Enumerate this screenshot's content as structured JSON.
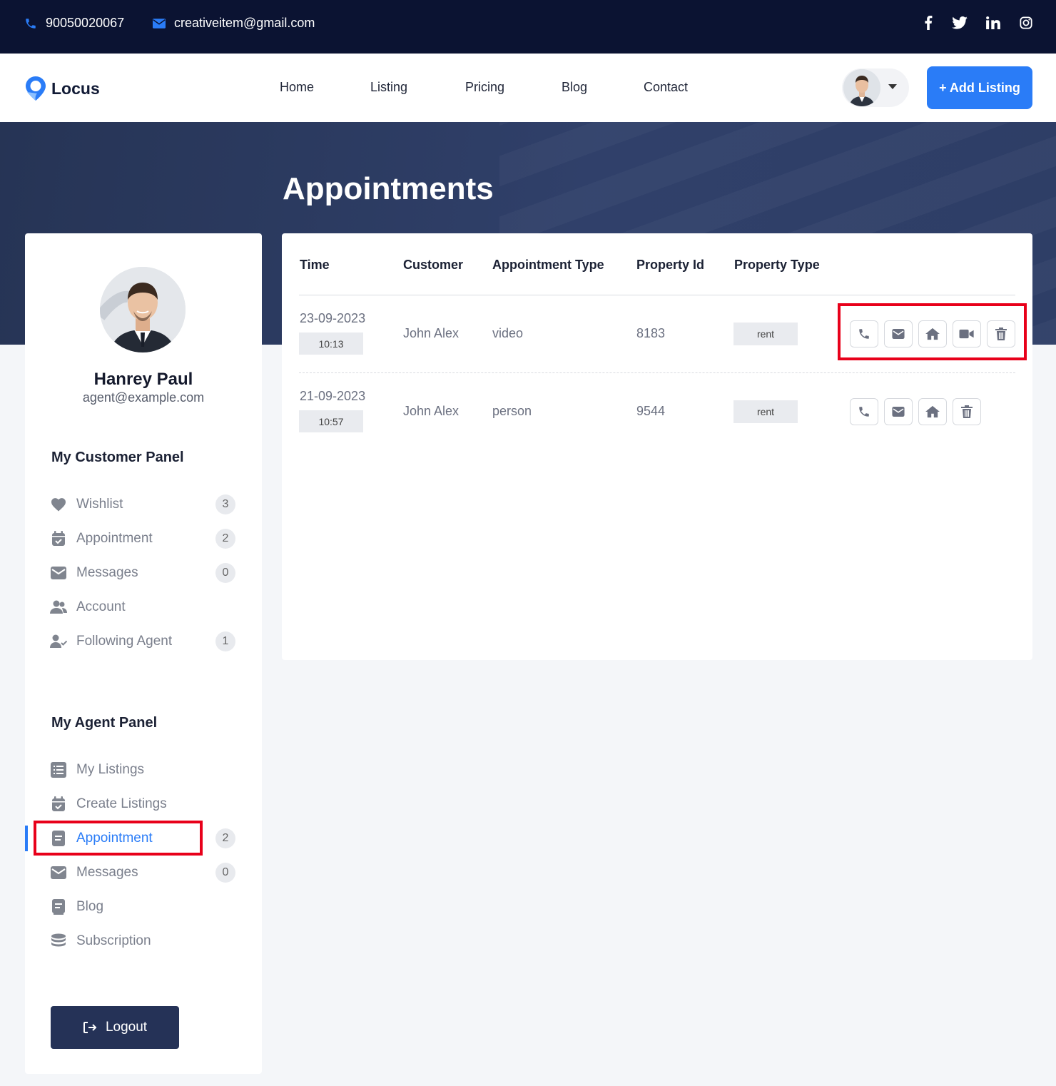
{
  "topbar": {
    "phone": "90050020067",
    "email": "creativeitem@gmail.com",
    "social_icons": [
      "facebook-icon",
      "twitter-icon",
      "linkedin-icon",
      "instagram-icon"
    ]
  },
  "header": {
    "logo_text": "Locus",
    "nav": [
      "Home",
      "Listing",
      "Pricing",
      "Blog",
      "Contact"
    ],
    "add_listing_label": "+ Add Listing"
  },
  "hero": {
    "title": "Appointments"
  },
  "profile": {
    "name": "Hanrey Paul",
    "email": "agent@example.com"
  },
  "customer_panel": {
    "title": "My Customer Panel",
    "items": [
      {
        "label": "Wishlist",
        "icon": "heart-icon",
        "badge": "3"
      },
      {
        "label": "Appointment",
        "icon": "calendar-check-icon",
        "badge": "2"
      },
      {
        "label": "Messages",
        "icon": "envelope-icon",
        "badge": "0"
      },
      {
        "label": "Account",
        "icon": "users-icon"
      },
      {
        "label": "Following Agent",
        "icon": "user-check-icon",
        "badge": "1"
      }
    ]
  },
  "agent_panel": {
    "title": "My Agent Panel",
    "items": [
      {
        "label": "My Listings",
        "icon": "list-icon"
      },
      {
        "label": "Create Listings",
        "icon": "calendar-check-icon"
      },
      {
        "label": "Appointment",
        "icon": "document-icon",
        "badge": "2",
        "active": true
      },
      {
        "label": "Messages",
        "icon": "envelope-icon",
        "badge": "0"
      },
      {
        "label": "Blog",
        "icon": "blog-icon"
      },
      {
        "label": "Subscription",
        "icon": "database-icon"
      }
    ]
  },
  "logout_label": "Logout",
  "table": {
    "headers": [
      "Time",
      "Customer",
      "Appointment Type",
      "Property Id",
      "Property Type"
    ],
    "rows": [
      {
        "date": "23-09-2023",
        "time": "10:13",
        "customer": "John Alex",
        "type": "video",
        "property_id": "8183",
        "property_type": "rent",
        "actions": [
          "phone-icon",
          "envelope-icon",
          "home-icon",
          "video-icon",
          "trash-icon"
        ]
      },
      {
        "date": "21-09-2023",
        "time": "10:57",
        "customer": "John Alex",
        "type": "person",
        "property_id": "9544",
        "property_type": "rent",
        "actions": [
          "phone-icon",
          "envelope-icon",
          "home-icon",
          "trash-icon"
        ]
      }
    ]
  },
  "colors": {
    "accent": "#2a7cf7",
    "topbar": "#0b1332",
    "hero": "#2c3a60",
    "highlight": "#e8001a"
  }
}
